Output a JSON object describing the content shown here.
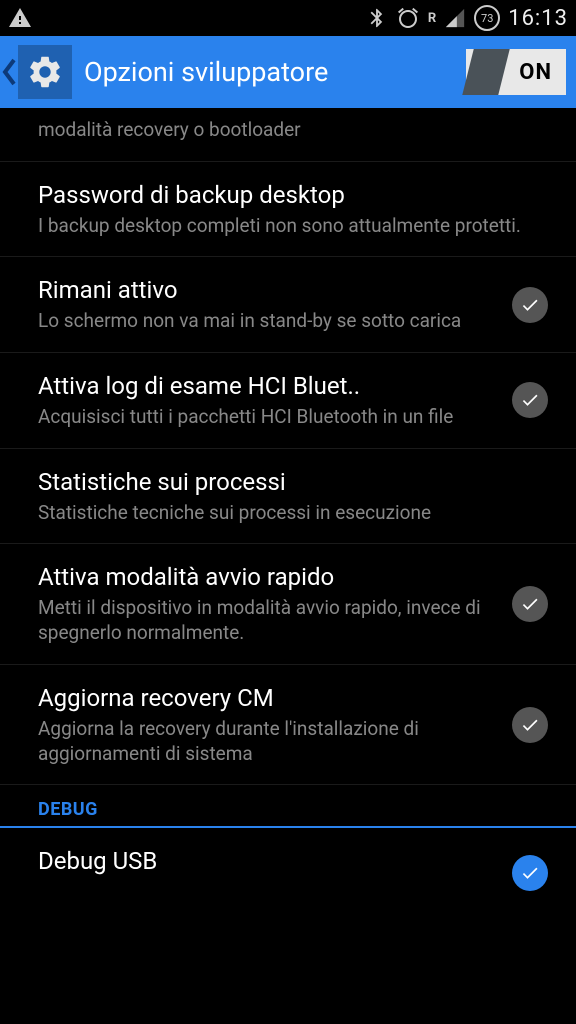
{
  "status": {
    "clock": "16:13",
    "battery": "73"
  },
  "header": {
    "title": "Opzioni sviluppatore",
    "toggle_label": "ON"
  },
  "items": {
    "partial": {
      "desc": "modalità recovery o bootloader"
    },
    "backup": {
      "title": "Password di backup desktop",
      "desc": "I backup desktop completi non sono attualmente protetti."
    },
    "stay_awake": {
      "title": "Rimani attivo",
      "desc": "Lo schermo non va mai in stand-by se sotto carica"
    },
    "bluetooth_log": {
      "title": "Attiva log di esame HCI Bluet..",
      "desc": "Acquisisci tutti i pacchetti HCI Bluetooth in un file"
    },
    "process_stats": {
      "title": "Statistiche sui processi",
      "desc": "Statistiche tecniche sui processi in esecuzione"
    },
    "fastboot": {
      "title": "Attiva modalità avvio rapido",
      "desc": "Metti il dispositivo in modalità avvio rapido, invece di spegnerlo normalmente."
    },
    "recovery": {
      "title": "Aggiorna recovery CM",
      "desc": "Aggiorna la recovery durante l'installazione di aggiornamenti di sistema"
    },
    "debug_header": "DEBUG",
    "debug_usb": {
      "title": "Debug USB"
    }
  }
}
